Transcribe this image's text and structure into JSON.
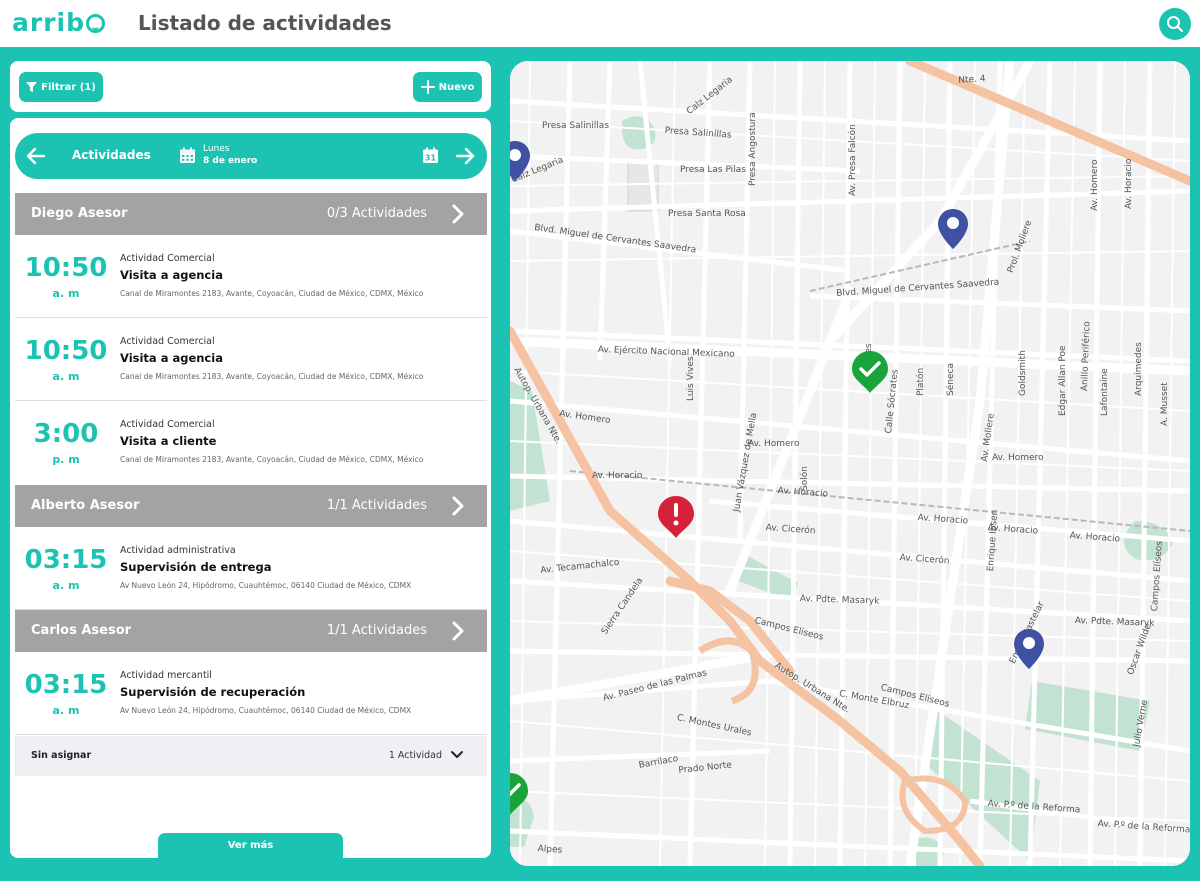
{
  "header": {
    "logo": "arrib",
    "title": "Listado de actividades"
  },
  "toolbar": {
    "filter_label": "Filtrar (1)",
    "new_label": "Nuevo"
  },
  "date_nav": {
    "label": "Actividades",
    "day": "Lunes",
    "date": "8 de enero",
    "calendar_day": "31"
  },
  "groups": [
    {
      "name": "Diego Asesor",
      "count": "0/3 Actividades",
      "activities": [
        {
          "time": "10:50",
          "ampm": "a. m",
          "type": "Actividad Comercial",
          "title": "Visita a agencia",
          "address": "Canal de Miramontes 2183, Avante, Coyoacán, Ciudad de México, CDMX, México"
        },
        {
          "time": "10:50",
          "ampm": "a. m",
          "type": "Actividad Comercial",
          "title": "Visita a agencia",
          "address": "Canal de Miramontes 2183, Avante, Coyoacán, Ciudad de México, CDMX, México"
        },
        {
          "time": "3:00",
          "ampm": "p. m",
          "type": "Actividad Comercial",
          "title": "Visita a cliente",
          "address": "Canal de Miramontes 2183, Avante, Coyoacán, Ciudad de México, CDMX, México"
        }
      ]
    },
    {
      "name": "Alberto Asesor",
      "count": "1/1 Actividades",
      "activities": [
        {
          "time": "03:15",
          "ampm": "a. m",
          "type": "Actividad administrativa",
          "title": "Supervisión de entrega",
          "address": "Av Nuevo León 24, Hipódromo, Cuauhtémoc, 06140 Ciudad de México, CDMX"
        }
      ]
    },
    {
      "name": "Carlos Asesor",
      "count": "1/1 Actividades",
      "activities": [
        {
          "time": "03:15",
          "ampm": "a. m",
          "type": "Actividad mercantil",
          "title": "Supervisión de recuperación",
          "address": "Av Nuevo León 24, Hipódromo, Cuauhtémoc, 06140 Ciudad de México, CDMX"
        }
      ]
    }
  ],
  "unassigned": {
    "label": "Sin asignar",
    "count": "1 Actividad"
  },
  "more_label": "Ver más",
  "map": {
    "streets": {
      "s1": "Nte. 4",
      "s2": "Calz Legaria",
      "s3": "Presa Salinillas",
      "s4": "Presa Salinillas",
      "s5": "Presa Angostura",
      "s6": "Presa Las Pilas",
      "s7": "Presa Santa Rosa",
      "s8": "Blvd. Miguel de Cervantes Saavedra",
      "s9": "Blvd. Miguel de Cervantes Saavedra",
      "s10": "Prol. Moliere",
      "s11": "Av. Ejército Nacional Mexicano",
      "s12": "Av. Homero",
      "s13": "Av. Homero",
      "s14": "Av. Homero",
      "s15": "Av. Horacio",
      "s16": "Av. Horacio",
      "s17": "Av. Horacio",
      "s18": "Av. Horacio",
      "s19": "Av. Horacio",
      "s20": "Av. Cicerón",
      "s21": "Av. Cicerón",
      "s22": "Av. Pdte. Masaryk",
      "s23": "Av. Pdte. Masaryk",
      "s24": "Av. Paseo de las Palmas",
      "s25": "Autop. Urbana Nte.",
      "s26": "Autop. Urbana Nte.",
      "s27": "Campos Elíseos",
      "s28": "Campos Elíseos",
      "s29": "C. Montes Urales",
      "s30": "C. Monte Elbruz",
      "s31": "Av. P.º de la Reforma",
      "s32": "Av. P.º de la Reforma",
      "s33": "Av. Moliere",
      "s34": "Juan Vázquez de Mella",
      "s35": "Av. Tecamachalco",
      "s36": "Calz Legaria",
      "s37": "Av. Presa Falcón",
      "s38": "Anillo Periférico",
      "s39": "Sierra Candela",
      "s40": "Alpes",
      "s41": "Prado Norte",
      "s42": "Barrilaco",
      "s43": "Sófocles",
      "s44": "Platón",
      "s45": "Séneca",
      "s46": "Goldsmith",
      "s47": "Edgar Allan Poe",
      "s48": "Lafontaine",
      "s49": "A. Musset",
      "s50": "Arquímedes",
      "s51": "Av. Horacio",
      "s52": "Luis Vives",
      "s53": "Solón",
      "s54": "Calle Sócrates",
      "s55": "Emilio Castelar",
      "s56": "Enrique Ibsen",
      "s57": "Oscar Wilde",
      "s58": "Julio Verne",
      "s59": "Campos Elíseos",
      "s60": "Av. Homero"
    }
  },
  "colors": {
    "accent": "#1cc3b2",
    "group_header": "#a3a3a3",
    "marker_blue": "#3f51a3",
    "marker_green": "#1aa33a",
    "marker_red": "#d6213a"
  },
  "icons": [
    "search-icon",
    "filter-icon",
    "plus-icon",
    "arrow-left-icon",
    "arrow-right-icon",
    "calendar-icon",
    "chevron-right-icon",
    "chevron-down-icon",
    "map-pin-icon",
    "check-marker-icon",
    "alert-marker-icon"
  ]
}
